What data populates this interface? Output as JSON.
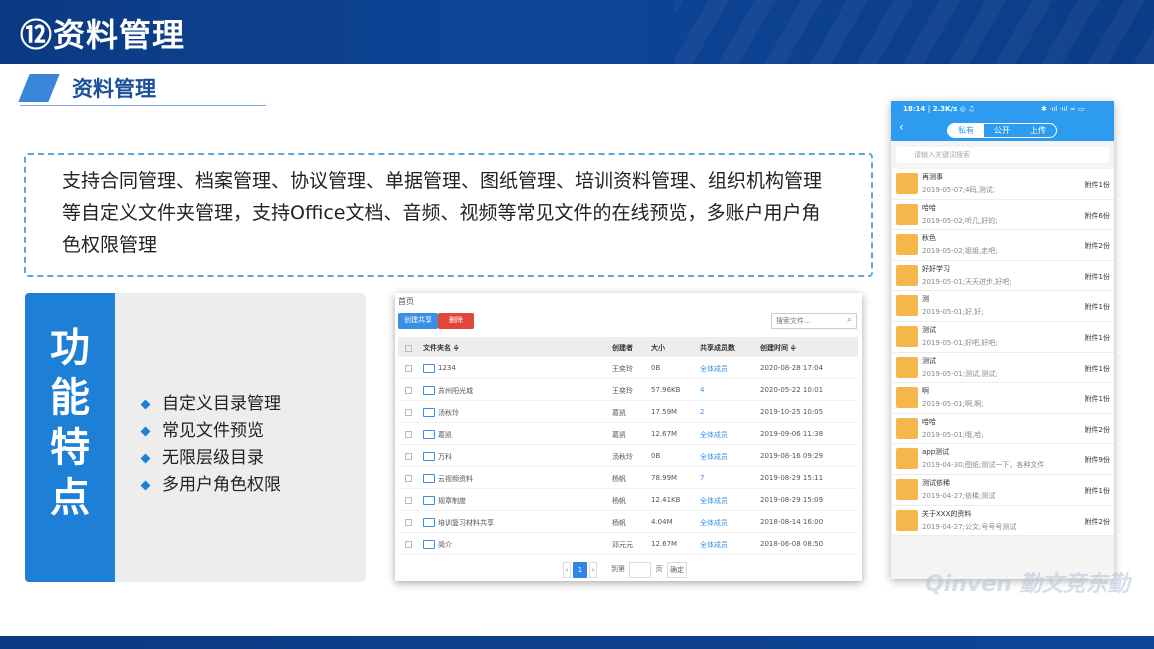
{
  "header": {
    "title": "⑫资料管理"
  },
  "section": {
    "title": "资料管理"
  },
  "intro": {
    "text": "支持合同管理、档案管理、协议管理、单据管理、图纸管理、培训资料管理、组织机构管理等自定义文件夹管理，支持Office文档、音频、视频等常见文件的在线预览，多账户用户角色权限管理"
  },
  "features": {
    "side_title": "功能特点",
    "items": [
      "自定义目录管理",
      "常见文件预览",
      "无限层级目录",
      "多用户角色权限"
    ]
  },
  "desktop": {
    "breadcrumb": "首页",
    "create_share_label": "创建共享",
    "delete_label": "删除",
    "search_placeholder": "搜索文件...",
    "columns": {
      "name": "文件夹名 ≑",
      "creator": "创建者",
      "size": "大小",
      "share": "共享成员数",
      "time": "创建时间 ≑"
    },
    "rows": [
      {
        "name": "1234",
        "creator": "王奕玲",
        "size": "0B",
        "share": "全体成员",
        "time": "2020-08-28 17:04"
      },
      {
        "name": "苏州阳光城",
        "creator": "王奕玲",
        "size": "57.96KB",
        "share": "4",
        "time": "2020-05-22 10:01"
      },
      {
        "name": "汤秋玲",
        "creator": "葛凯",
        "size": "17.59M",
        "share": "2",
        "time": "2019-10-25 10:05"
      },
      {
        "name": "葛凯",
        "creator": "葛凯",
        "size": "12.67M",
        "share": "全体成员",
        "time": "2019-09-06 11:38"
      },
      {
        "name": "万科",
        "creator": "汤秋玲",
        "size": "0B",
        "share": "全体成员",
        "time": "2019-08-16 09:29"
      },
      {
        "name": "云视频资料",
        "creator": "杨帆",
        "size": "78.99M",
        "share": "7",
        "time": "2019-08-29 15:11"
      },
      {
        "name": "规章制度",
        "creator": "杨帆",
        "size": "12.41KB",
        "share": "全体成员",
        "time": "2019-08-29 15:09"
      },
      {
        "name": "培训复习材料共享",
        "creator": "杨帆",
        "size": "4.04M",
        "share": "全体成员",
        "time": "2018-08-14 16:00"
      },
      {
        "name": "简介",
        "creator": "邓元元",
        "size": "12.67M",
        "share": "全体成员",
        "time": "2018-06-08 08:50"
      }
    ],
    "pager": {
      "prev": "‹",
      "current": "1",
      "next": "›",
      "goto": "到第",
      "page": "页",
      "confirm": "确定"
    }
  },
  "phone": {
    "status_left": "18:14 | 2.3K/s ◎ ♫",
    "status_right": "✱ ‧ııl ‧ııl ≈ ▭",
    "back": "‹",
    "tabs": [
      "私有",
      "公开",
      "上传"
    ],
    "search_placeholder": "请输入关键词搜索",
    "items": [
      {
        "title": "再测事",
        "sub": "2019-05-07;4码,测试;",
        "count": "附件1份"
      },
      {
        "title": "哈哈",
        "sub": "2019-05-02;听几,好的;",
        "count": "附件6份"
      },
      {
        "title": "秋色",
        "sub": "2019-05-02;姐姐,走吧;",
        "count": "附件2份"
      },
      {
        "title": "好好学习",
        "sub": "2019-05-01;天天进步,好吧;",
        "count": "附件1份"
      },
      {
        "title": "测",
        "sub": "2019-05-01;好,好;",
        "count": "附件1份"
      },
      {
        "title": "测试",
        "sub": "2019-05-01;好吧,好吧;",
        "count": "附件1份"
      },
      {
        "title": "测试",
        "sub": "2019-05-01;测试,测试;",
        "count": "附件1份"
      },
      {
        "title": "啊",
        "sub": "2019-05-01;啊,啊;",
        "count": "附件1份"
      },
      {
        "title": "哈哈",
        "sub": "2019-05-01;哦,哈;",
        "count": "附件2份"
      },
      {
        "title": "app测试",
        "sub": "2019-04-30;图纸;测试一下，各种文件",
        "count": "附件9份"
      },
      {
        "title": "测试依稀",
        "sub": "2019-04-27;依稀;测试",
        "count": "附件1份"
      },
      {
        "title": "关于XXX的资料",
        "sub": "2019-04-27;公文;号号号测试",
        "count": "附件2份"
      }
    ]
  },
  "watermark": "Qinven 勤文竞东勤"
}
